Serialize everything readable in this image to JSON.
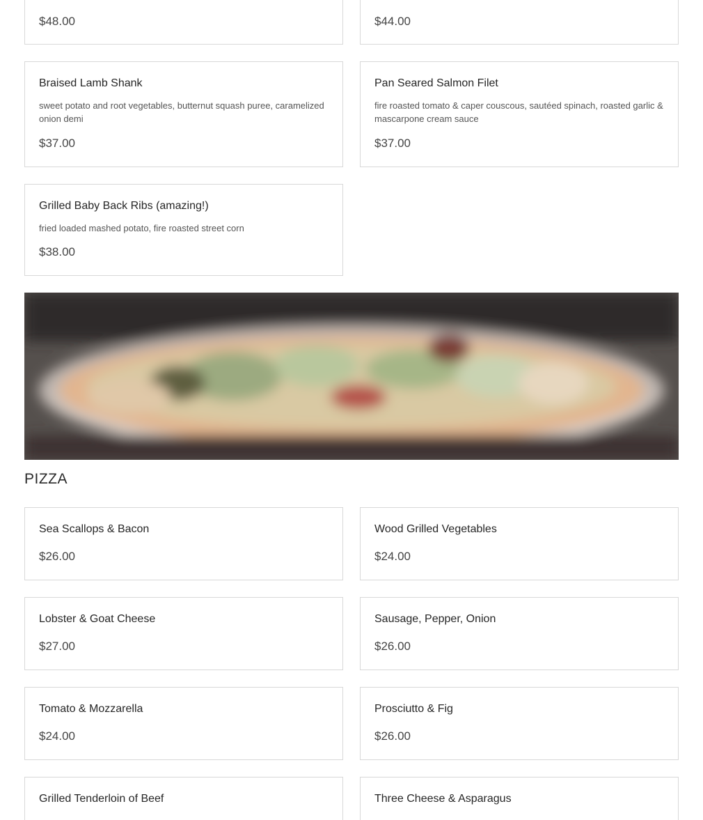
{
  "partial_top": {
    "left_price": "$48.00",
    "right_price": "$44.00"
  },
  "entrees": [
    {
      "name": "Braised Lamb Shank",
      "description": "sweet potato and root vegetables, butternut squash puree, caramelized onion demi",
      "price": "$37.00"
    },
    {
      "name": "Pan Seared Salmon Filet",
      "description": "fire roasted tomato & caper couscous, sautéed spinach, roasted garlic & mascarpone cream sauce",
      "price": "$37.00"
    },
    {
      "name": "Grilled Baby Back Ribs (amazing!)",
      "description": "fried loaded mashed potato, fire roasted street corn",
      "price": "$38.00"
    }
  ],
  "pizza_section": {
    "title": "PIZZA",
    "items": [
      {
        "name": "Sea Scallops & Bacon",
        "price": "$26.00"
      },
      {
        "name": "Wood Grilled Vegetables",
        "price": "$24.00"
      },
      {
        "name": "Lobster & Goat Cheese",
        "price": "$27.00"
      },
      {
        "name": "Sausage, Pepper, Onion",
        "price": "$26.00"
      },
      {
        "name": "Tomato & Mozzarella",
        "price": "$24.00"
      },
      {
        "name": "Prosciutto & Fig",
        "price": "$26.00"
      },
      {
        "name": "Grilled Tenderloin of Beef",
        "price": ""
      },
      {
        "name": "Three Cheese & Asparagus",
        "price": ""
      }
    ]
  }
}
